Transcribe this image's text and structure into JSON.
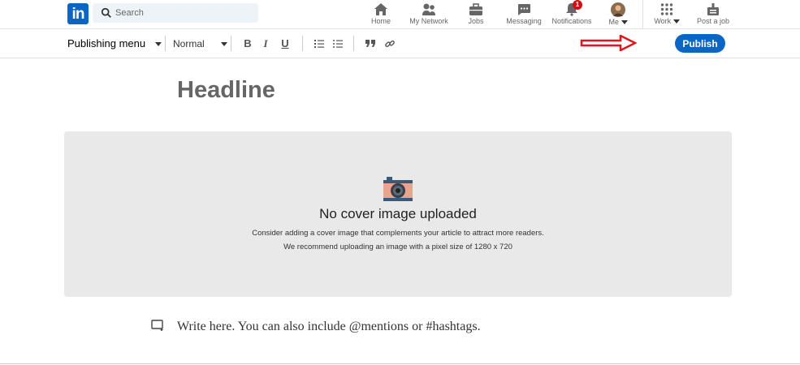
{
  "search": {
    "placeholder": "Search"
  },
  "nav": {
    "home": "Home",
    "network": "My Network",
    "jobs": "Jobs",
    "messaging": "Messaging",
    "notifications": "Notifications",
    "notifications_count": "1",
    "me": "Me",
    "work": "Work",
    "post_job": "Post a job"
  },
  "toolbar": {
    "publishing_menu": "Publishing menu",
    "text_style": "Normal",
    "bold": "B",
    "italic": "I",
    "underline": "U",
    "publish": "Publish"
  },
  "editor": {
    "headline": "Headline",
    "cover_title": "No cover image uploaded",
    "cover_line1": "Consider adding a cover image that complements your article to attract more readers.",
    "cover_line2": "We recommend uploading an image with a pixel size of 1280 x 720",
    "body_placeholder": "Write here. You can also include @mentions or #hashtags."
  },
  "colors": {
    "brand": "#0a66c2",
    "badge": "#cc1016",
    "annotation_arrow": "#e0161e"
  },
  "icons": [
    "linkedin-logo",
    "search-icon",
    "home-icon",
    "network-icon",
    "briefcase-icon",
    "messaging-icon",
    "bell-icon",
    "grid-icon",
    "post-job-icon",
    "camera-icon",
    "embed-icon"
  ]
}
